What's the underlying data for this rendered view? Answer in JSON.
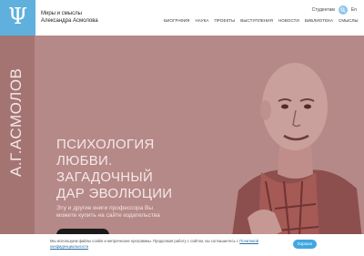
{
  "header": {
    "logo_symbol": "Ψ",
    "site_title_line1": "Миры и смыслы",
    "site_title_line2": "Александра Асмолова",
    "students_link": "Студентам",
    "language": "En",
    "nav": [
      "БИОГРАФИЯ",
      "НАУКА",
      "ПРОЕКТЫ",
      "ВЫСТУПЛЕНИЯ",
      "НОВОСТИ",
      "БИБЛИОТЕКА",
      "СМЫСЛЫ"
    ]
  },
  "sidebar": {
    "name": "А.Г.АСМОЛОВ"
  },
  "hero": {
    "title_lines": [
      "ПСИХОЛОГИЯ",
      "ЛЮБВИ.",
      "ЗАГАДОЧНЫЙ",
      "ДАР ЭВОЛЮЦИИ"
    ],
    "subtitle_lines": [
      "Эту и другие книги профессора Вы",
      "можете купить на сайте издательства"
    ]
  },
  "cookie": {
    "text": "Мы используем файлы cookie и метрические программы. Продолжая работу с сайтом, вы соглашаетесь с",
    "link_line1": "Политикой",
    "link_line2": "конфиденциальности",
    "accept_label": "Хорошо"
  },
  "colors": {
    "accent": "#5fb0dd",
    "hero_bg": "#b58988",
    "sidebar_bg": "#a47473",
    "button": "#41a7e0"
  },
  "icons": {
    "search": "search-icon",
    "logo": "psi-logo-icon"
  }
}
